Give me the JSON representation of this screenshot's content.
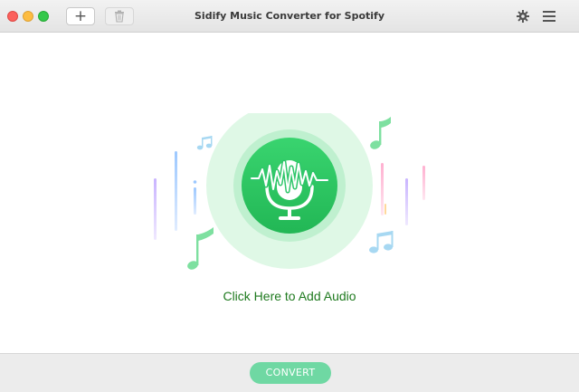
{
  "window": {
    "title": "Sidify Music Converter for Spotify"
  },
  "toolbar": {
    "add_icon": "plus-icon",
    "add_label": "+",
    "delete_icon": "trash-icon",
    "settings_icon": "gear-icon",
    "menu_icon": "hamburger-menu-icon"
  },
  "main": {
    "drop_icon": "microphone-waveform-icon",
    "add_audio_label": "Click Here to Add Audio"
  },
  "footer": {
    "convert_label": "CONVERT"
  },
  "colors": {
    "accent_green": "#2fc66a",
    "label_green": "#1f7a1f",
    "convert_button": "#6fd8a3",
    "note_green": "#7ee0a0",
    "note_blue": "#a7d8f2"
  }
}
